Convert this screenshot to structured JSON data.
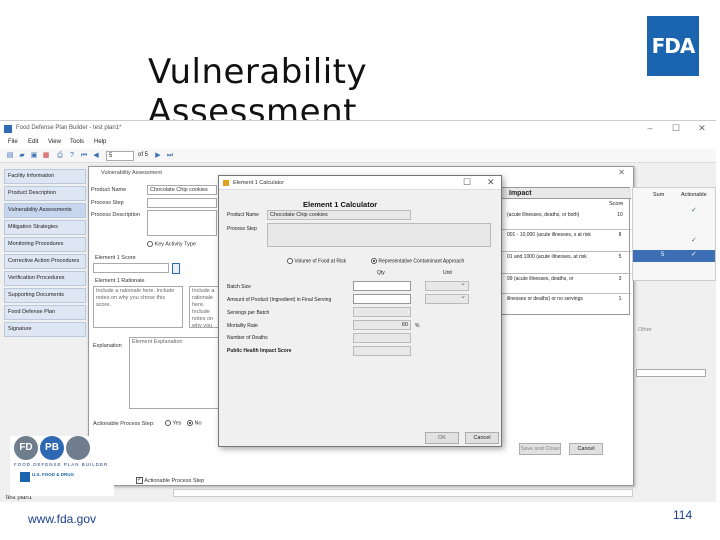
{
  "slide": {
    "title": "Vulnerability Assessment",
    "logo_text": "FDA",
    "footer_url": "www.fda.gov",
    "page_number": "114"
  },
  "app": {
    "window_title": "Food Defense Plan Builder - test plan1*",
    "menu": [
      "File",
      "Edit",
      "View",
      "Tools",
      "Help"
    ],
    "toolbar": {
      "page_value": "5",
      "page_of": "of 5"
    },
    "status_text": "test plan1",
    "actionable_checkbox_label": "Actionable Process Step"
  },
  "nav": {
    "items": [
      "Facility Information",
      "Product Description",
      "Vulnerability Assessments",
      "Mitigation Strategies",
      "Monitoring Procedures",
      "Corrective Action Procedures",
      "Verification Procedures",
      "Supporting Documents",
      "Food Defense Plan",
      "Signature"
    ],
    "active_index": 2
  },
  "va_dialog": {
    "title": "Vulnerability Assessment",
    "product_name_label": "Product Name",
    "product_name_value": "Chocolate Chip cookies",
    "process_step_label": "Process Step",
    "process_description_label": "Process Description",
    "key_activity_label": "Key Activity Type",
    "element_score_label": "Element 1 Score",
    "element_rationale_label": "Element 1 Rationale",
    "rationale_placeholder": "Include a rationale here. Include notes on why you chose this score.",
    "explanation_label": "Explanation",
    "explanation_placeholder": "Element Explanation",
    "actionable_label": "Actionable Process Step:",
    "yes_label": "Yes",
    "no_label": "No",
    "save_button": "Save and Close",
    "cancel_button": "Cancel"
  },
  "impact_table": {
    "heading": "Impact",
    "score_header": "Score",
    "rows": [
      {
        "desc": "(acute illnesses, deaths, or both)",
        "score": "10"
      },
      {
        "desc": "001 - 10,000 (acute illnesses, s at risk",
        "score": "8"
      },
      {
        "desc": "01 and 1000 (acute illnesses, at risk",
        "score": "5"
      },
      {
        "desc": "99 (acute illnesses, deaths, or",
        "score": "3"
      },
      {
        "desc": "illnesses or deaths) or no servings",
        "score": "1"
      }
    ],
    "sum_header": "Sum",
    "actionable_header": "Actionable",
    "sum_value": "5",
    "other_label": "Other"
  },
  "calculator": {
    "window_title": "Element 1 Calculator",
    "heading": "Element 1 Calculator",
    "product_name_label": "Product Name",
    "product_name_value": "Chocolate Chip cookies",
    "process_step_label": "Process Step",
    "radio_volume": "Volume of Food at Risk",
    "radio_representative": "Representative Contaminant Approach",
    "qty_header": "Qty",
    "unit_header": "Unit",
    "batch_size_label": "Batch Size",
    "amount_label": "Amount of Product (Ingredient) in Final Serving",
    "servings_label": "Servings per Batch",
    "mortality_label": "Mortality Rate",
    "mortality_value": "60",
    "mortality_unit": "%",
    "deaths_label": "Number of Deaths",
    "impact_score_label": "Public Health Impact Score",
    "ok_button": "OK",
    "cancel_button": "Cancel"
  },
  "fdpb_logo": {
    "left": "FD",
    "right": "PB",
    "caption": "FOOD DEFENSE PLAN BUILDER",
    "agency": "U.S. FOOD & DRUG"
  },
  "colors": {
    "fda_blue": "#1a64b0",
    "nav_bg": "#dde6f2",
    "logo_gray": "#6f7d8c",
    "logo_blue": "#2f68b2"
  }
}
